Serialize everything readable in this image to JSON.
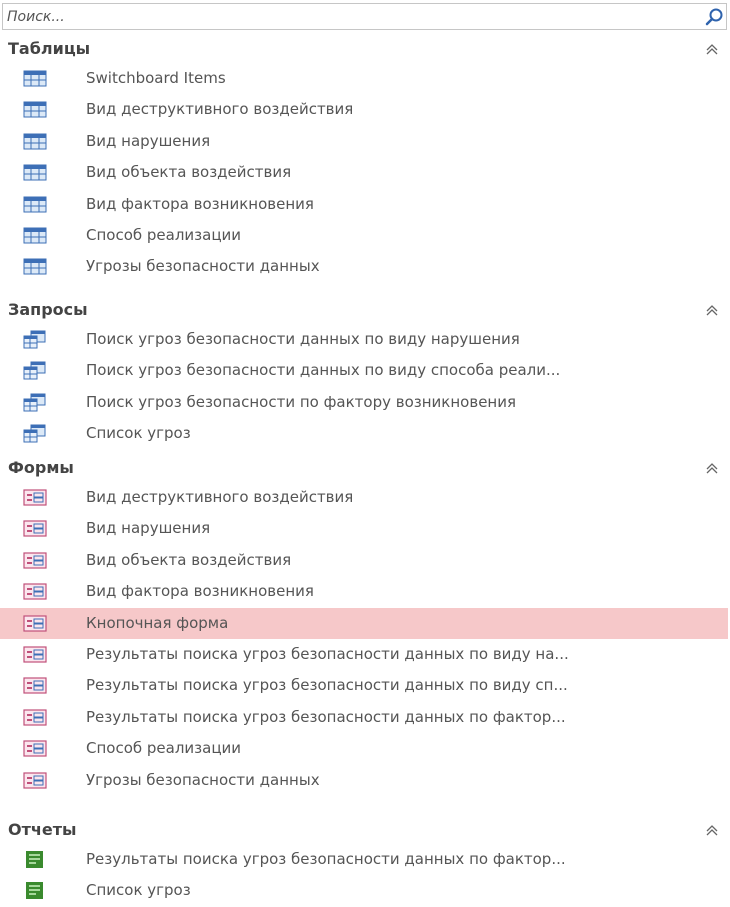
{
  "search": {
    "placeholder": "Поиск..."
  },
  "groups": [
    {
      "title": "Таблицы",
      "items": [
        {
          "label": "Switchboard Items"
        },
        {
          "label": "Вид деструктивного воздействия"
        },
        {
          "label": "Вид нарушения"
        },
        {
          "label": "Вид объекта воздействия"
        },
        {
          "label": "Вид фактора возникновения"
        },
        {
          "label": "Способ реализации"
        },
        {
          "label": "Угрозы безопасности данных"
        }
      ]
    },
    {
      "title": "Запросы",
      "items": [
        {
          "label": "Поиск угроз безопасности данных по виду нарушения"
        },
        {
          "label": "Поиск угроз безопасности данных по виду способа реали..."
        },
        {
          "label": "Поиск угроз безопасности по фактору возникновения"
        },
        {
          "label": "Список угроз"
        }
      ]
    },
    {
      "title": "Формы",
      "items": [
        {
          "label": "Вид деструктивного воздействия"
        },
        {
          "label": "Вид нарушения"
        },
        {
          "label": "Вид объекта воздействия"
        },
        {
          "label": "Вид фактора возникновения"
        },
        {
          "label": "Кнопочная форма"
        },
        {
          "label": "Результаты поиска угроз безопасности данных по виду на..."
        },
        {
          "label": "Результаты поиска угроз безопасности данных по виду сп..."
        },
        {
          "label": "Результаты поиска угроз безопасности данных по фактор..."
        },
        {
          "label": "Способ реализации"
        },
        {
          "label": "Угрозы безопасности данных"
        }
      ]
    },
    {
      "title": "Отчеты",
      "items": [
        {
          "label": "Результаты поиска угроз безопасности данных по фактор..."
        },
        {
          "label": "Список угроз"
        }
      ]
    }
  ],
  "selected_item": "Кнопочная форма",
  "icons": {
    "group_0": "table-icon",
    "group_1": "query-icon",
    "group_2": "form-icon",
    "group_3": "report-icon",
    "collapse": "double-chevron-up-icon",
    "search": "search-icon"
  },
  "colors": {
    "selection": "#f6c8c9",
    "table_icon": "#3d6fb6",
    "report_icon": "#3a8a2e"
  }
}
